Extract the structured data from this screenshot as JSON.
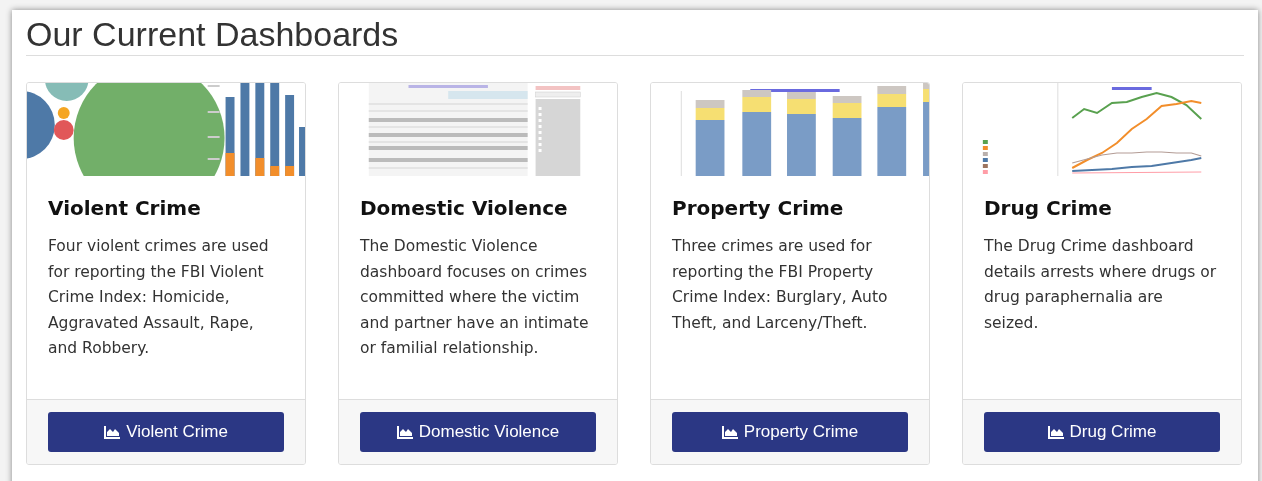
{
  "heading": "Our Current Dashboards",
  "cards": [
    {
      "thumbnail": {
        "kind": "bubbles"
      },
      "title": "Violent Crime",
      "text": "Four violent crimes are used for reporting the FBI Violent Crime Index: Homicide, Aggravated Assault, Rape, and Robbery.",
      "button": "Violent Crime"
    },
    {
      "thumbnail": {
        "kind": "table"
      },
      "title": "Domestic Violence",
      "text": "The Domestic Violence dashboard focuses on crimes committed where the victim and partner have an intimate or familial relationship.",
      "button": "Domestic Violence"
    },
    {
      "thumbnail": {
        "kind": "bars"
      },
      "title": "Property Crime",
      "text": "Three crimes are used for reporting the FBI Property Crime Index: Burglary, Auto Theft, and Larceny/Theft.",
      "button": "Property Crime"
    },
    {
      "thumbnail": {
        "kind": "lines"
      },
      "title": "Drug Crime",
      "text": "The Drug Crime dashboard details arrests where drugs or drug paraphernalia are seized.",
      "button": "Drug Crime"
    }
  ]
}
